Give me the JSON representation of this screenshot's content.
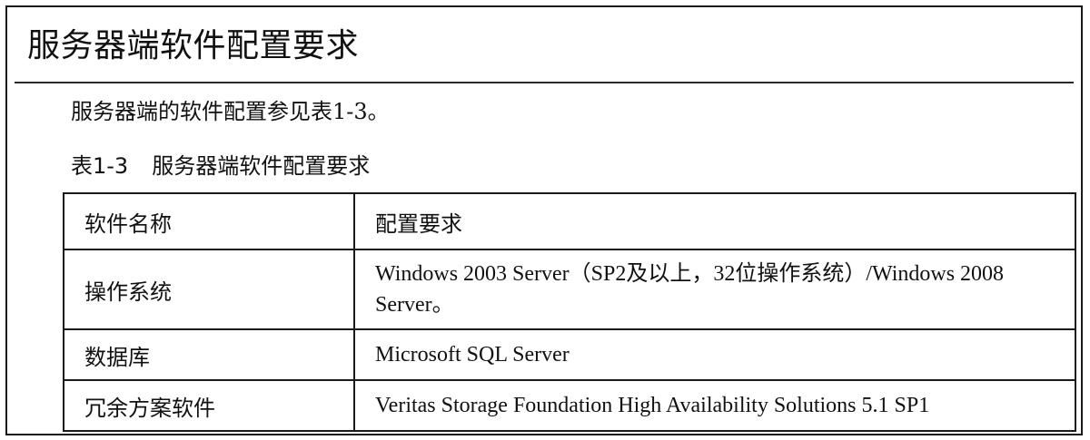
{
  "section": {
    "heading": "服务器端软件配置要求"
  },
  "intro_text": "服务器端的软件配置参见表1-3。",
  "table_caption": {
    "number": "表1-3",
    "title": "服务器端软件配置要求"
  },
  "table": {
    "headers": [
      "软件名称",
      "配置要求"
    ],
    "rows": [
      {
        "name": "操作系统",
        "requirement": "Windows 2003 Server（SP2及以上，32位操作系统）/Windows 2008 Server。"
      },
      {
        "name": "数据库",
        "requirement": "Microsoft SQL Server"
      },
      {
        "name": "冗余方案软件",
        "requirement": "Veritas Storage Foundation High Availability Solutions 5.1 SP1"
      }
    ]
  }
}
